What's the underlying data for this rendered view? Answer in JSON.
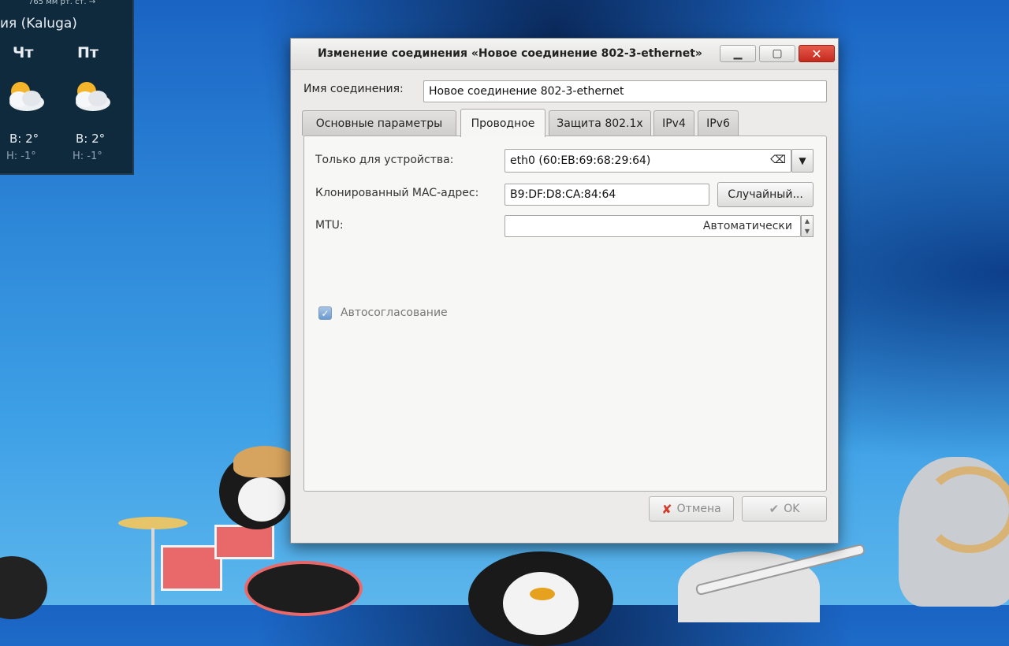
{
  "weather": {
    "pressure": "765 мм рт. ст. →",
    "city": "ия (Kaluga)",
    "days": [
      {
        "name": "Чт",
        "high": "В: 2°",
        "low": "Н: -1°"
      },
      {
        "name": "Пт",
        "high": "В: 2°",
        "low": "Н: -1°"
      }
    ]
  },
  "dialog": {
    "title": "Изменение соединения «Новое соединение 802-3-ethernet»",
    "window_buttons": {
      "minimize": "▁",
      "maximize": "▢",
      "close": "✕"
    },
    "connection_name_label": "Имя соединения:",
    "connection_name_value": "Новое соединение 802-3-ethernet",
    "tabs": [
      {
        "label": "Основные параметры",
        "active": false
      },
      {
        "label": "Проводное",
        "active": true
      },
      {
        "label": "Защита 802.1x",
        "active": false
      },
      {
        "label": "IPv4",
        "active": false
      },
      {
        "label": "IPv6",
        "active": false
      }
    ],
    "wired": {
      "device_label": "Только для устройства:",
      "device_value": "eth0 (60:EB:69:68:29:64)",
      "cloned_mac_label": "Клонированный MAC-адрес:",
      "cloned_mac_value": "B9:DF:D8:CA:84:64",
      "random_button": "Случайный...",
      "mtu_label": "MTU:",
      "mtu_value": "Автоматически",
      "autoneg_label": "Автосогласование",
      "autoneg_checked": true
    },
    "buttons": {
      "cancel": "Отмена",
      "ok": "OK"
    }
  },
  "colors": {
    "close_button": "#d2392b",
    "checkbox": "#6a99cf",
    "titlebar": "#e8e7e5"
  }
}
